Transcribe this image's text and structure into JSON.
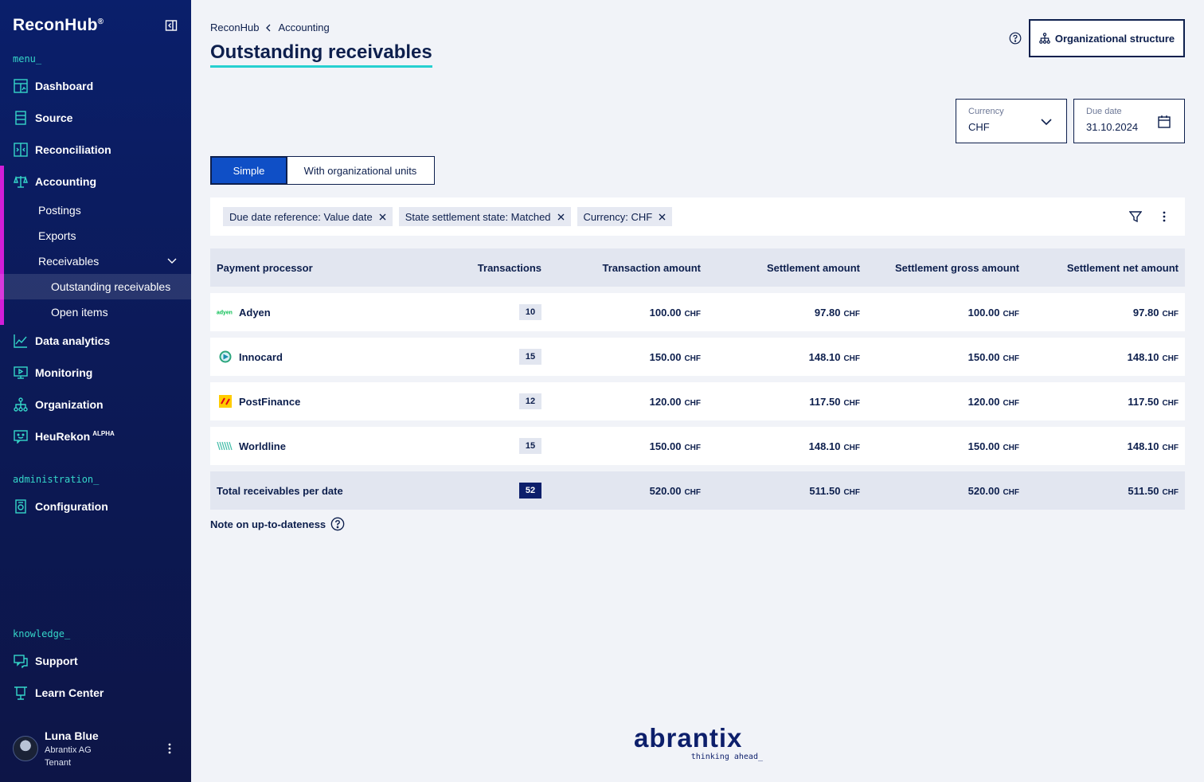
{
  "app": {
    "name": "ReconHub",
    "reg": "®"
  },
  "sidebar": {
    "menu_label": "menu_",
    "items": [
      {
        "label": "Dashboard",
        "icon": "dashboard-icon"
      },
      {
        "label": "Source",
        "icon": "source-icon"
      },
      {
        "label": "Reconciliation",
        "icon": "reconciliation-icon"
      },
      {
        "label": "Accounting",
        "icon": "scale-icon"
      },
      {
        "label": "Data analytics",
        "icon": "chart-line-icon"
      },
      {
        "label": "Monitoring",
        "icon": "monitor-icon"
      },
      {
        "label": "Organization",
        "icon": "org-tree-icon"
      },
      {
        "label": "HeuRekon",
        "badge": "ALPHA",
        "icon": "chat-bot-icon"
      }
    ],
    "accounting_sub": [
      "Postings",
      "Exports",
      "Receivables"
    ],
    "receivables_sub": [
      "Outstanding receivables",
      "Open items"
    ],
    "admin_label": "administration_",
    "admin_items": [
      {
        "label": "Configuration",
        "icon": "config-icon"
      }
    ],
    "knowledge_label": "knowledge_",
    "knowledge_items": [
      {
        "label": "Support",
        "icon": "support-icon"
      },
      {
        "label": "Learn Center",
        "icon": "learn-icon"
      }
    ],
    "accent_color": "#d21ed7",
    "label_color": "#35d6c9"
  },
  "user": {
    "name": "Luna Blue",
    "org": "Abrantix AG",
    "role": "Tenant"
  },
  "breadcrumb": {
    "root": "ReconHub",
    "current": "Accounting"
  },
  "page": {
    "title": "Outstanding receivables"
  },
  "header": {
    "org_button": "Organizational structure"
  },
  "filters": {
    "currency": {
      "label": "Currency",
      "value": "CHF"
    },
    "due_date": {
      "label": "Due date",
      "value": "31.10.2024"
    }
  },
  "view_toggle": {
    "simple": "Simple",
    "org_units": "With organizational units",
    "selected": "Simple"
  },
  "chips": [
    "Due date reference: Value date",
    "State settlement state: Matched",
    "Currency: CHF"
  ],
  "table": {
    "headers": [
      "Payment processor",
      "Transactions",
      "Transaction amount",
      "Settlement amount",
      "Settlement gross amount",
      "Settlement net amount"
    ],
    "currency": "CHF",
    "rows": [
      {
        "processor": "Adyen",
        "logo": "adyen-logo",
        "tx": "10",
        "tx_amount": "100.00",
        "settle": "97.80",
        "gross": "100.00",
        "net": "97.80"
      },
      {
        "processor": "Innocard",
        "logo": "innocard-logo",
        "tx": "15",
        "tx_amount": "150.00",
        "settle": "148.10",
        "gross": "150.00",
        "net": "148.10"
      },
      {
        "processor": "PostFinance",
        "logo": "postfinance-logo",
        "tx": "12",
        "tx_amount": "120.00",
        "settle": "117.50",
        "gross": "120.00",
        "net": "117.50"
      },
      {
        "processor": "Worldline",
        "logo": "worldline-logo",
        "tx": "15",
        "tx_amount": "150.00",
        "settle": "148.10",
        "gross": "150.00",
        "net": "148.10"
      }
    ],
    "total": {
      "label": "Total receivables per date",
      "tx": "52",
      "tx_amount": "520.00",
      "settle": "511.50",
      "gross": "520.00",
      "net": "511.50"
    }
  },
  "note": "Note on up-to-dateness",
  "footer": {
    "brand": "abrantix",
    "tagline": "thinking ahead_"
  }
}
